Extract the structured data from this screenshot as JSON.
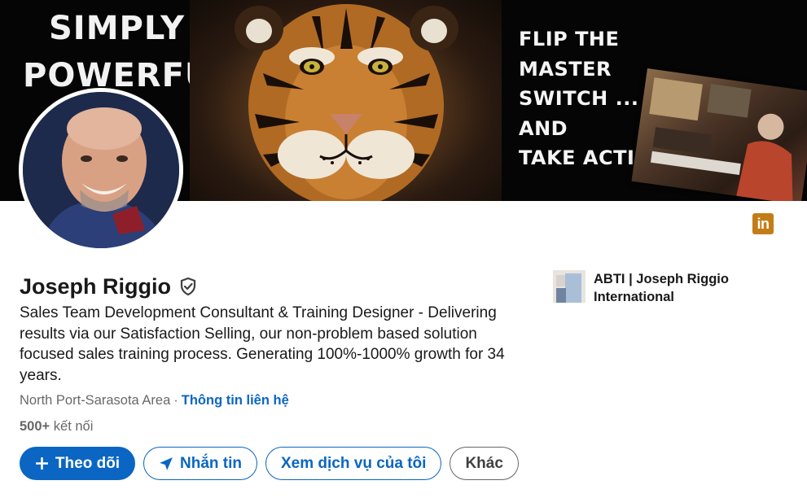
{
  "banner": {
    "left_text_line1": "SIMPLY",
    "left_text_line2": "POWERFUL.",
    "right_text_lines": [
      "FLIP THE",
      "MASTER",
      "SWITCH ...",
      "AND",
      "TAKE ACTION!"
    ]
  },
  "profile": {
    "name": "Joseph Riggio",
    "headline": "Sales Team Development Consultant & Training Designer - Delivering results via our Satisfaction Selling, our non-problem based solution focused sales training process. Generating 100%-1000% growth for 34 years.",
    "location": "North Port-Sarasota Area",
    "contact_link": "Thông tin liên hệ",
    "connections_count": "500+",
    "connections_label": "kết nối"
  },
  "company": {
    "name": "ABTI | Joseph Riggio International"
  },
  "actions": {
    "follow": "Theo dõi",
    "message": "Nhắn tin",
    "services": "Xem dịch vụ của tôi",
    "more": "Khác"
  },
  "badge": {
    "label": "in"
  },
  "colors": {
    "primary": "#0a66c2",
    "badge": "#c37d16"
  },
  "icons": {
    "verified": "verified-shield-icon",
    "plus": "plus-icon",
    "send": "send-icon",
    "linkedin": "linkedin-icon"
  }
}
